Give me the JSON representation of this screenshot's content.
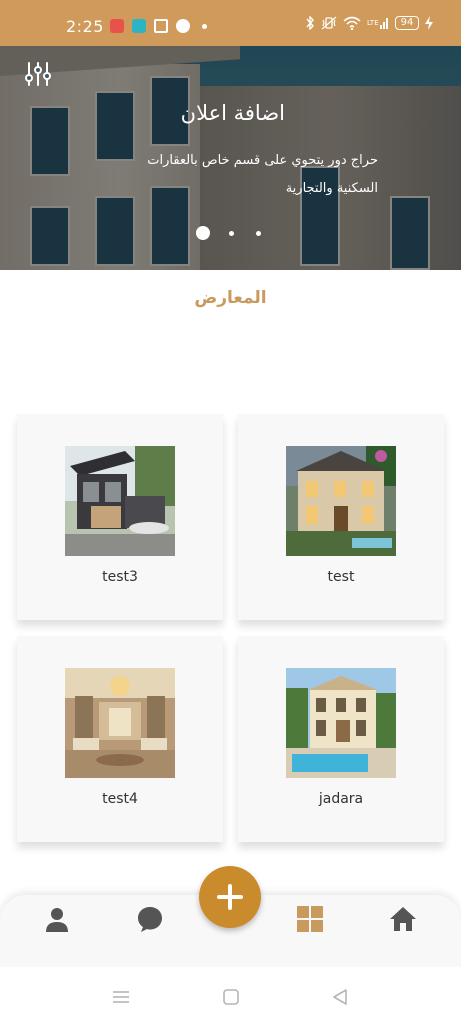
{
  "status_bar": {
    "time": "2:25",
    "battery": "94",
    "icons": [
      "music-app-icon",
      "message-app-icon",
      "news-app-icon",
      "map-pin-app-icon",
      "bluetooth-icon",
      "vibrate-icon",
      "wifi-icon",
      "signal-icon",
      "battery-icon"
    ]
  },
  "hero": {
    "title": "اضافة اعلان",
    "subtitle": "حراج دور يتحوي على قسم خاص بالعقارات السكنية والتجارية",
    "slides": 3,
    "active_slide": 1
  },
  "section": {
    "title": "المعارض"
  },
  "listings": [
    {
      "name": "test"
    },
    {
      "name": "test3"
    },
    {
      "name": "jadara"
    },
    {
      "name": "test4"
    }
  ],
  "bottom_nav": {
    "items": [
      "profile-icon",
      "chat-icon",
      "add-icon",
      "grid-icon",
      "home-icon"
    ],
    "active": "grid-icon"
  },
  "colors": {
    "accent": "#cf9a5a",
    "fab": "#c98b2b",
    "section_title": "#c99a5e"
  }
}
